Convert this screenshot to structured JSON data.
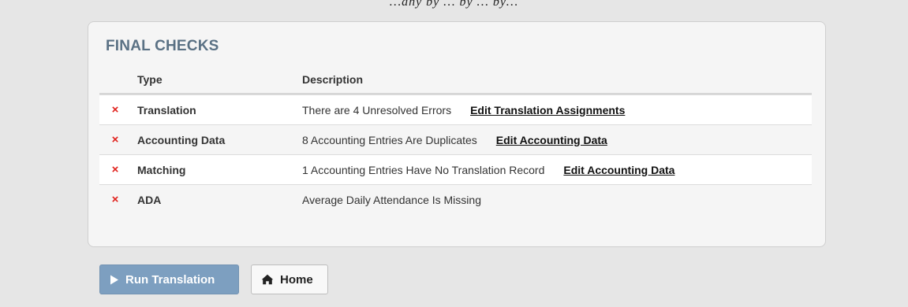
{
  "page": {
    "top_fragment": "…any by … by … by…"
  },
  "panel": {
    "title": "FINAL CHECKS",
    "columns": [
      "Type",
      "Description"
    ],
    "rows": [
      {
        "type": "Translation",
        "description": "There are 4 Unresolved Errors",
        "link": "Edit Translation Assignments",
        "status_icon": "x-icon",
        "status_color": "#e0201b"
      },
      {
        "type": "Accounting Data",
        "description": "8 Accounting Entries Are Duplicates",
        "link": "Edit Accounting Data",
        "status_icon": "x-icon",
        "status_color": "#e0201b"
      },
      {
        "type": "Matching",
        "description": "1 Accounting Entries Have No Translation Record",
        "link": "Edit Accounting Data",
        "status_icon": "x-icon",
        "status_color": "#e0201b"
      },
      {
        "type": "ADA",
        "description": "Average Daily Attendance Is Missing",
        "link": "",
        "status_icon": "x-icon",
        "status_color": "#e0201b"
      }
    ]
  },
  "status_mark": "×",
  "buttons": {
    "run_translation": {
      "label": "Run Translation",
      "icon": "play-icon",
      "state": "disabled-looking"
    },
    "home": {
      "label": "Home",
      "icon": "home-icon"
    }
  },
  "colors": {
    "title": "#5a7184",
    "error": "#e0201b",
    "run_button": "#7d9fc0"
  }
}
